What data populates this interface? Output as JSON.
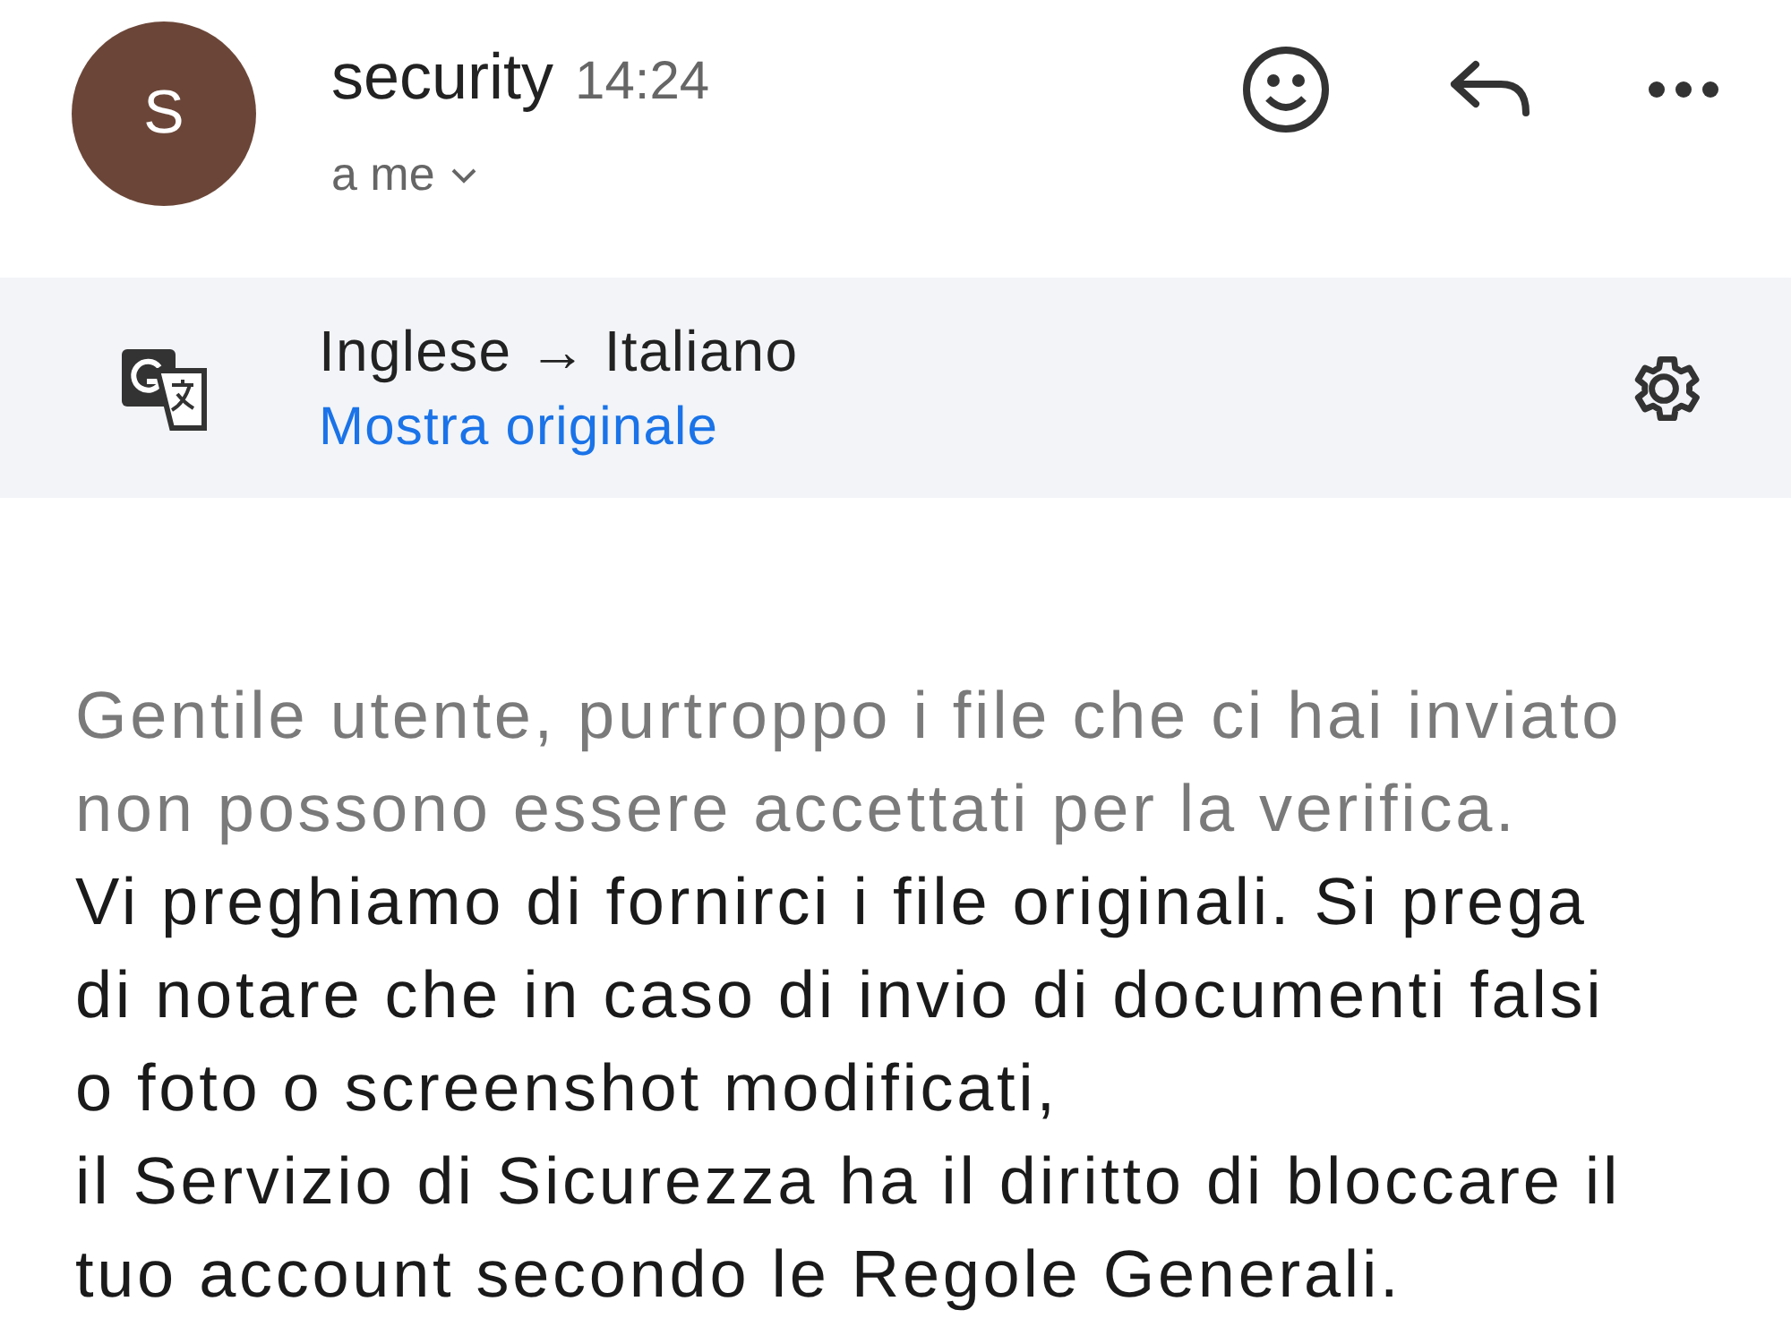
{
  "header": {
    "avatar_letter": "S",
    "sender": "security",
    "time": "14:24",
    "recipient": "a me"
  },
  "translation": {
    "languages": "Inglese → Italiano",
    "link": "Mostra originale"
  },
  "paragraphs": [
    {
      "text": "Gentile utente, purtroppo i file che ci hai inviato non possono essere accettati per la verifica.",
      "muted": true
    },
    {
      "text": "Vi preghiamo di fornirci i file originali. Si prega di notare che in caso di invio di documenti falsi o foto o screenshot modificati,",
      "muted": false
    },
    {
      "text": "il Servizio di Sicurezza ha il diritto di bloccare il tuo account secondo le Regole Generali.",
      "muted": false
    }
  ]
}
